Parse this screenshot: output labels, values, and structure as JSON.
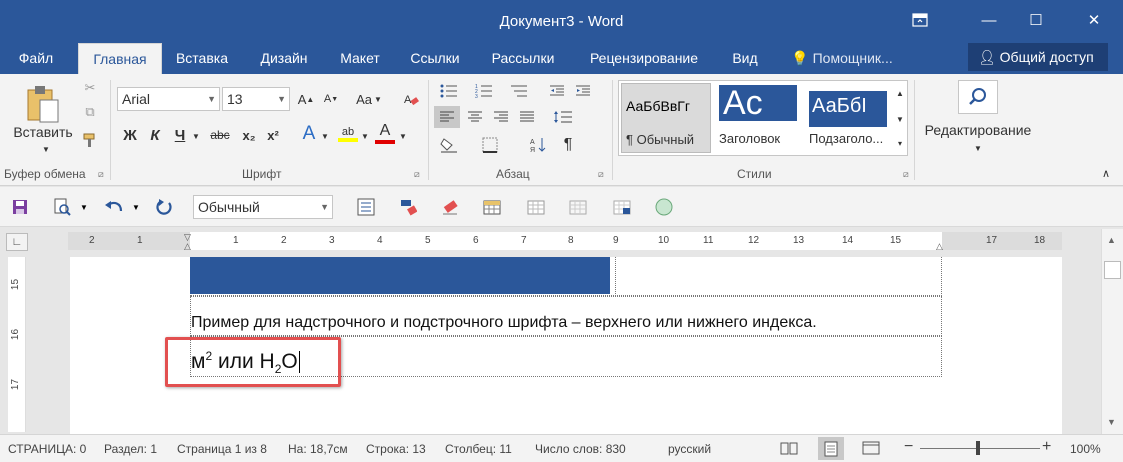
{
  "window": {
    "title": "Документ3 - Word",
    "restore_icon": "ribbon-display-icon",
    "minimize_glyph": "—",
    "maximize_glyph": "☐",
    "close_glyph": "✕"
  },
  "tabs": [
    {
      "label": "Файл"
    },
    {
      "label": "Главная",
      "active": true
    },
    {
      "label": "Вставка"
    },
    {
      "label": "Дизайн"
    },
    {
      "label": "Макет"
    },
    {
      "label": "Ссылки"
    },
    {
      "label": "Рассылки"
    },
    {
      "label": "Рецензирование"
    },
    {
      "label": "Вид"
    },
    {
      "label": "Помощник..."
    }
  ],
  "share_label": "Общий доступ",
  "ribbon": {
    "clipboard": {
      "label": "Буфер обмена",
      "paste_label": "Вставить"
    },
    "font": {
      "label": "Шрифт",
      "font_name": "Arial",
      "font_size": "13",
      "bold": "Ж",
      "italic": "К",
      "underline": "Ч",
      "strike": "abc",
      "subscript": "x₂",
      "superscript": "x²",
      "case": "Aa",
      "text_effect": "A",
      "highlight": "ab",
      "font_color": "A",
      "highlight_color": "#ffff00",
      "font_color_value": "#e00000"
    },
    "paragraph": {
      "label": "Абзац",
      "pilcrow": "¶"
    },
    "styles": {
      "label": "Стили",
      "items": [
        {
          "preview": "АаБбВвГг",
          "caption": "¶ Обычный"
        },
        {
          "preview": "Ac",
          "caption": "Заголовок"
        },
        {
          "preview": "АаБбI",
          "caption": "Подзаголо..."
        }
      ]
    },
    "editing": {
      "label": "Редактирование"
    }
  },
  "qat": {
    "style_value": "Обычный"
  },
  "ruler": {
    "h_numbers": [
      "2",
      "1",
      "1",
      "2",
      "3",
      "4",
      "5",
      "6",
      "7",
      "8",
      "9",
      "10",
      "11",
      "12",
      "13",
      "14",
      "15",
      "17",
      "18"
    ],
    "v_numbers": [
      "15",
      "16",
      "17"
    ]
  },
  "document": {
    "sentence": "Пример для надстрочного и подстрочного шрифта – верхнего или нижнего индекса.",
    "formula_m": "м",
    "formula_sup": "2",
    "formula_mid": " или H",
    "formula_sub": "2",
    "formula_o": "O",
    "table_fill_color": "#2b579a",
    "highlight_color": "#e25050"
  },
  "status": {
    "page": "СТРАНИЦА: 0",
    "section": "Раздел: 1",
    "pages": "Страница 1 из 8",
    "position": "На: 18,7см",
    "line": "Строка: 13",
    "column": "Столбец: 11",
    "words": "Число слов: 830",
    "language": "русский",
    "zoom_minus": "−",
    "zoom_plus": "+",
    "zoom": "100%"
  }
}
